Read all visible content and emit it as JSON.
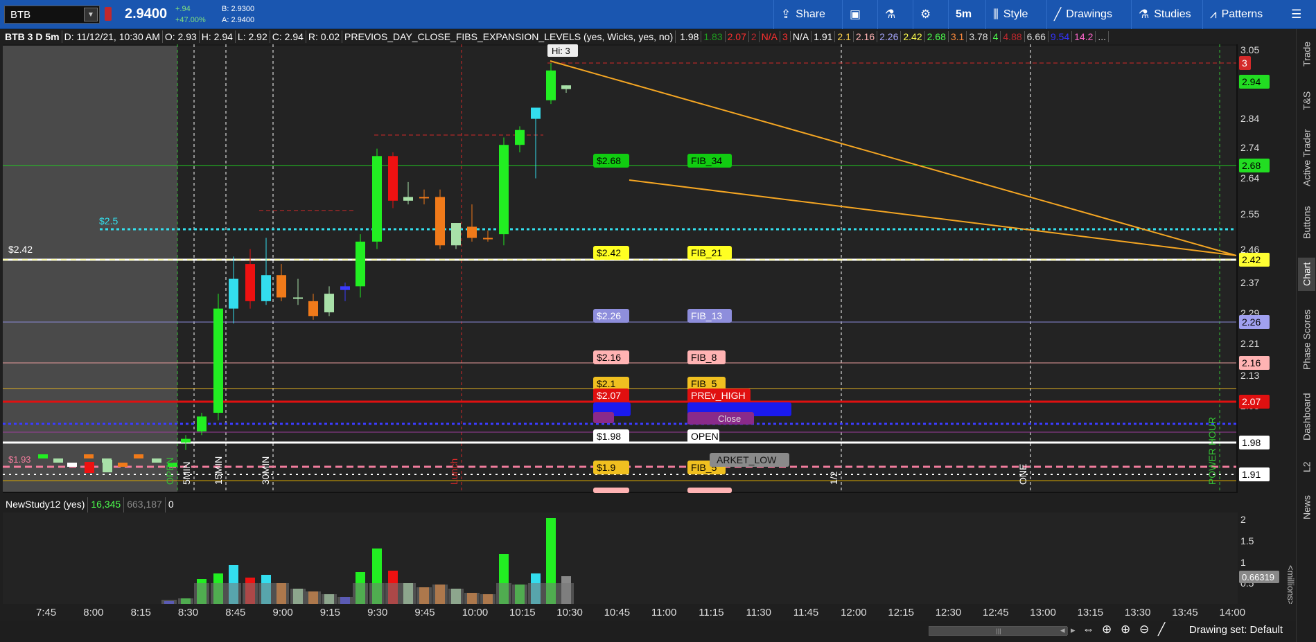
{
  "toolbar": {
    "symbol": "BTB",
    "last_price": "2.9400",
    "change_abs": "+.94",
    "change_pct": "+47.00%",
    "bid": "B: 2.9300",
    "ask": "A: 2.9400",
    "share_label": "Share",
    "timeframe_label": "5m",
    "style_label": "Style",
    "drawings_label": "Drawings",
    "studies_label": "Studies",
    "patterns_label": "Patterns"
  },
  "header": {
    "chart_id": "BTB 3 D 5m",
    "date": "D: 11/12/21, 10:30 AM",
    "open": "O: 2.93",
    "high": "H: 2.94",
    "low": "L: 2.92",
    "close": "C: 2.94",
    "range": "R: 0.02",
    "study": "PREVIOS_DAY_CLOSE_FIBS_EXPANSION_LEVELS (yes, Wicks, yes, no)",
    "values": [
      {
        "text": "1.98",
        "color": "#ffffff"
      },
      {
        "text": "1.83",
        "color": "#1f9e1f"
      },
      {
        "text": "2.07",
        "color": "#ff3030"
      },
      {
        "text": "2",
        "color": "#c0282e"
      },
      {
        "text": "N/A",
        "color": "#ff3030"
      },
      {
        "text": "3",
        "color": "#ff3030"
      },
      {
        "text": "N/A",
        "color": "#ffffff"
      },
      {
        "text": "1.91",
        "color": "#ffffff"
      },
      {
        "text": "2.1",
        "color": "#ffd34d"
      },
      {
        "text": "2.16",
        "color": "#ffb3b3"
      },
      {
        "text": "2.26",
        "color": "#a8a8ff"
      },
      {
        "text": "2.42",
        "color": "#ffff4d"
      },
      {
        "text": "2.68",
        "color": "#4dff4d"
      },
      {
        "text": "3.1",
        "color": "#ff8a3d"
      },
      {
        "text": "3.78",
        "color": "#dddddd"
      },
      {
        "text": "4",
        "color": "#4dff4d"
      },
      {
        "text": "4.88",
        "color": "#c0282e"
      },
      {
        "text": "6.66",
        "color": "#dddddd"
      },
      {
        "text": "9.54",
        "color": "#3333ff"
      },
      {
        "text": "14.2",
        "color": "#ff66cc"
      },
      {
        "text": "...",
        "color": "#dddddd"
      }
    ]
  },
  "price_axis": {
    "ticks": [
      "3.05",
      "2.84",
      "2.74",
      "2.64",
      "2.55",
      "2.46",
      "2.37",
      "2.29",
      "2.21",
      "2.13",
      "2.05"
    ],
    "badges": [
      {
        "text": "3",
        "bg": "#d42a2a",
        "fg": "#ffffff"
      },
      {
        "text": "2.94",
        "bg": "#22dd22",
        "fg": "#000000"
      },
      {
        "text": "2.68",
        "bg": "#22dd22",
        "fg": "#000000"
      },
      {
        "text": "2.42",
        "bg": "#ffff33",
        "fg": "#000000"
      },
      {
        "text": "2.26",
        "bg": "#a0a0f0",
        "fg": "#000000"
      },
      {
        "text": "2.16",
        "bg": "#ffb3b3",
        "fg": "#000000"
      },
      {
        "text": "2.07",
        "bg": "#e01010",
        "fg": "#ffffff"
      },
      {
        "text": "1.98",
        "bg": "#ffffff",
        "fg": "#000000"
      },
      {
        "text": "1.91",
        "bg": "#ffffff",
        "fg": "#000000"
      }
    ]
  },
  "level_labels": {
    "price_tags": [
      "$2.68",
      "$2.42",
      "$2.26",
      "$2.16",
      "$2.1",
      "$2.07",
      "$1.98",
      "$1.9"
    ],
    "fib_tags": [
      "FIB_34",
      "FIB_21",
      "FIB_13",
      "FIB_8",
      "FIB_5",
      "PREv_HIGH",
      "OPEN",
      "FIB_5"
    ],
    "market_low": "ARKET_LOW",
    "prev_close": "Close",
    "hi_label": "Hi: 3",
    "left_2_5": "$2.5",
    "left_2_42": "$2.42",
    "left_1_93": "$1.93"
  },
  "time_markers": [
    "OPEN",
    "5MIN",
    "15MIN",
    "30MIN",
    "Lunch",
    "1/2",
    "ONE",
    "POWER HOUR"
  ],
  "lower_study": {
    "name": "NewStudy12 (yes)",
    "v1": "16,345",
    "v2": "663,187",
    "v3": "0",
    "axis": [
      "2",
      "1.5",
      "1",
      "0.5"
    ],
    "current": "0.66319",
    "unit": "<millions>"
  },
  "time_axis": [
    "7:45",
    "8:00",
    "8:15",
    "8:30",
    "8:45",
    "9:00",
    "9:15",
    "9:30",
    "9:45",
    "10:00",
    "10:15",
    "10:30",
    "10:45",
    "11:00",
    "11:15",
    "11:30",
    "11:45",
    "12:00",
    "12:15",
    "12:30",
    "12:45",
    "13:00",
    "13:15",
    "13:30",
    "13:45",
    "14:00"
  ],
  "sidebar_tabs": [
    "Trade",
    "T&S",
    "Active Trader",
    "Buttons",
    "Chart",
    "Phase Scores",
    "Dashboard",
    "L2",
    "News"
  ],
  "bottom": {
    "drawing_set": "Drawing set: Default"
  }
}
